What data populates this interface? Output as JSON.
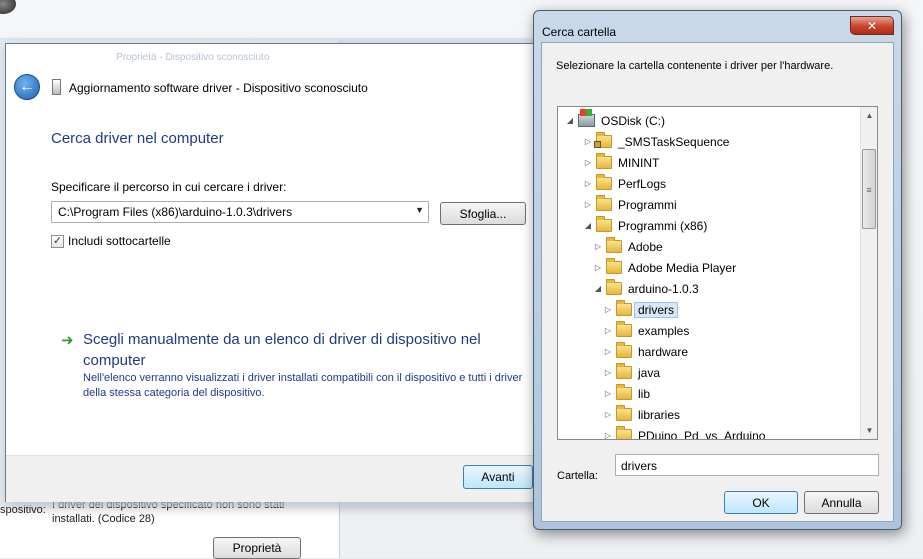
{
  "background": {
    "status_label": "spositivo:",
    "status_text": "I driver del dispositivo specificato non sono stati installati. (Codice 28)",
    "properties_button": "Proprietà"
  },
  "wizard": {
    "ghost_title": "Proprietà - Dispositivo sconosciuto",
    "title": "Aggiornamento software driver - Dispositivo sconosciuto",
    "heading": "Cerca driver nel computer",
    "path_label": "Specificare il percorso in cui cercare i driver:",
    "path_value": "C:\\Program Files (x86)\\arduino-1.0.3\\drivers",
    "browse_button": "Sfoglia...",
    "include_subfolders": "Includi sottocartelle",
    "include_subfolders_checked": true,
    "manual_option_title": "Scegli manualmente da un elenco di driver di dispositivo nel computer",
    "manual_option_desc": "Nell'elenco verranno visualizzati i driver installati compatibili con il dispositivo e tutti i driver della stessa categoria del dispositivo.",
    "next_button": "Avanti"
  },
  "dialog": {
    "title": "Cerca cartella",
    "close_glyph": "✕",
    "instruction": "Selezionare la cartella contenente i driver per l'hardware.",
    "tree": [
      {
        "label": "OSDisk (C:)",
        "level": 0,
        "expanded": true,
        "icon": "drive-icon"
      },
      {
        "label": "_SMSTaskSequence",
        "level": 1,
        "expanded": false,
        "icon": "locked-folder-icon"
      },
      {
        "label": "MININT",
        "level": 1,
        "expanded": false,
        "icon": "folder-icon"
      },
      {
        "label": "PerfLogs",
        "level": 1,
        "expanded": false,
        "icon": "folder-icon"
      },
      {
        "label": "Programmi",
        "level": 1,
        "expanded": false,
        "icon": "folder-icon"
      },
      {
        "label": "Programmi (x86)",
        "level": 1,
        "expanded": true,
        "icon": "folder-icon"
      },
      {
        "label": "Adobe",
        "level": 2,
        "expanded": false,
        "icon": "folder-icon"
      },
      {
        "label": "Adobe Media Player",
        "level": 2,
        "expanded": false,
        "icon": "folder-icon"
      },
      {
        "label": "arduino-1.0.3",
        "level": 2,
        "expanded": true,
        "icon": "folder-icon"
      },
      {
        "label": "drivers",
        "level": 3,
        "expanded": false,
        "icon": "folder-icon",
        "selected": true
      },
      {
        "label": "examples",
        "level": 3,
        "expanded": false,
        "icon": "folder-icon"
      },
      {
        "label": "hardware",
        "level": 3,
        "expanded": false,
        "icon": "folder-icon"
      },
      {
        "label": "java",
        "level": 3,
        "expanded": false,
        "icon": "folder-icon"
      },
      {
        "label": "lib",
        "level": 3,
        "expanded": false,
        "icon": "folder-icon"
      },
      {
        "label": "libraries",
        "level": 3,
        "expanded": false,
        "icon": "folder-icon"
      },
      {
        "label": "PDuino_Pd_vs_Arduino",
        "level": 3,
        "expanded": false,
        "icon": "folder-icon"
      }
    ],
    "folder_label": "Cartella:",
    "folder_value": "drivers",
    "ok_button": "OK",
    "cancel_button": "Annulla"
  }
}
